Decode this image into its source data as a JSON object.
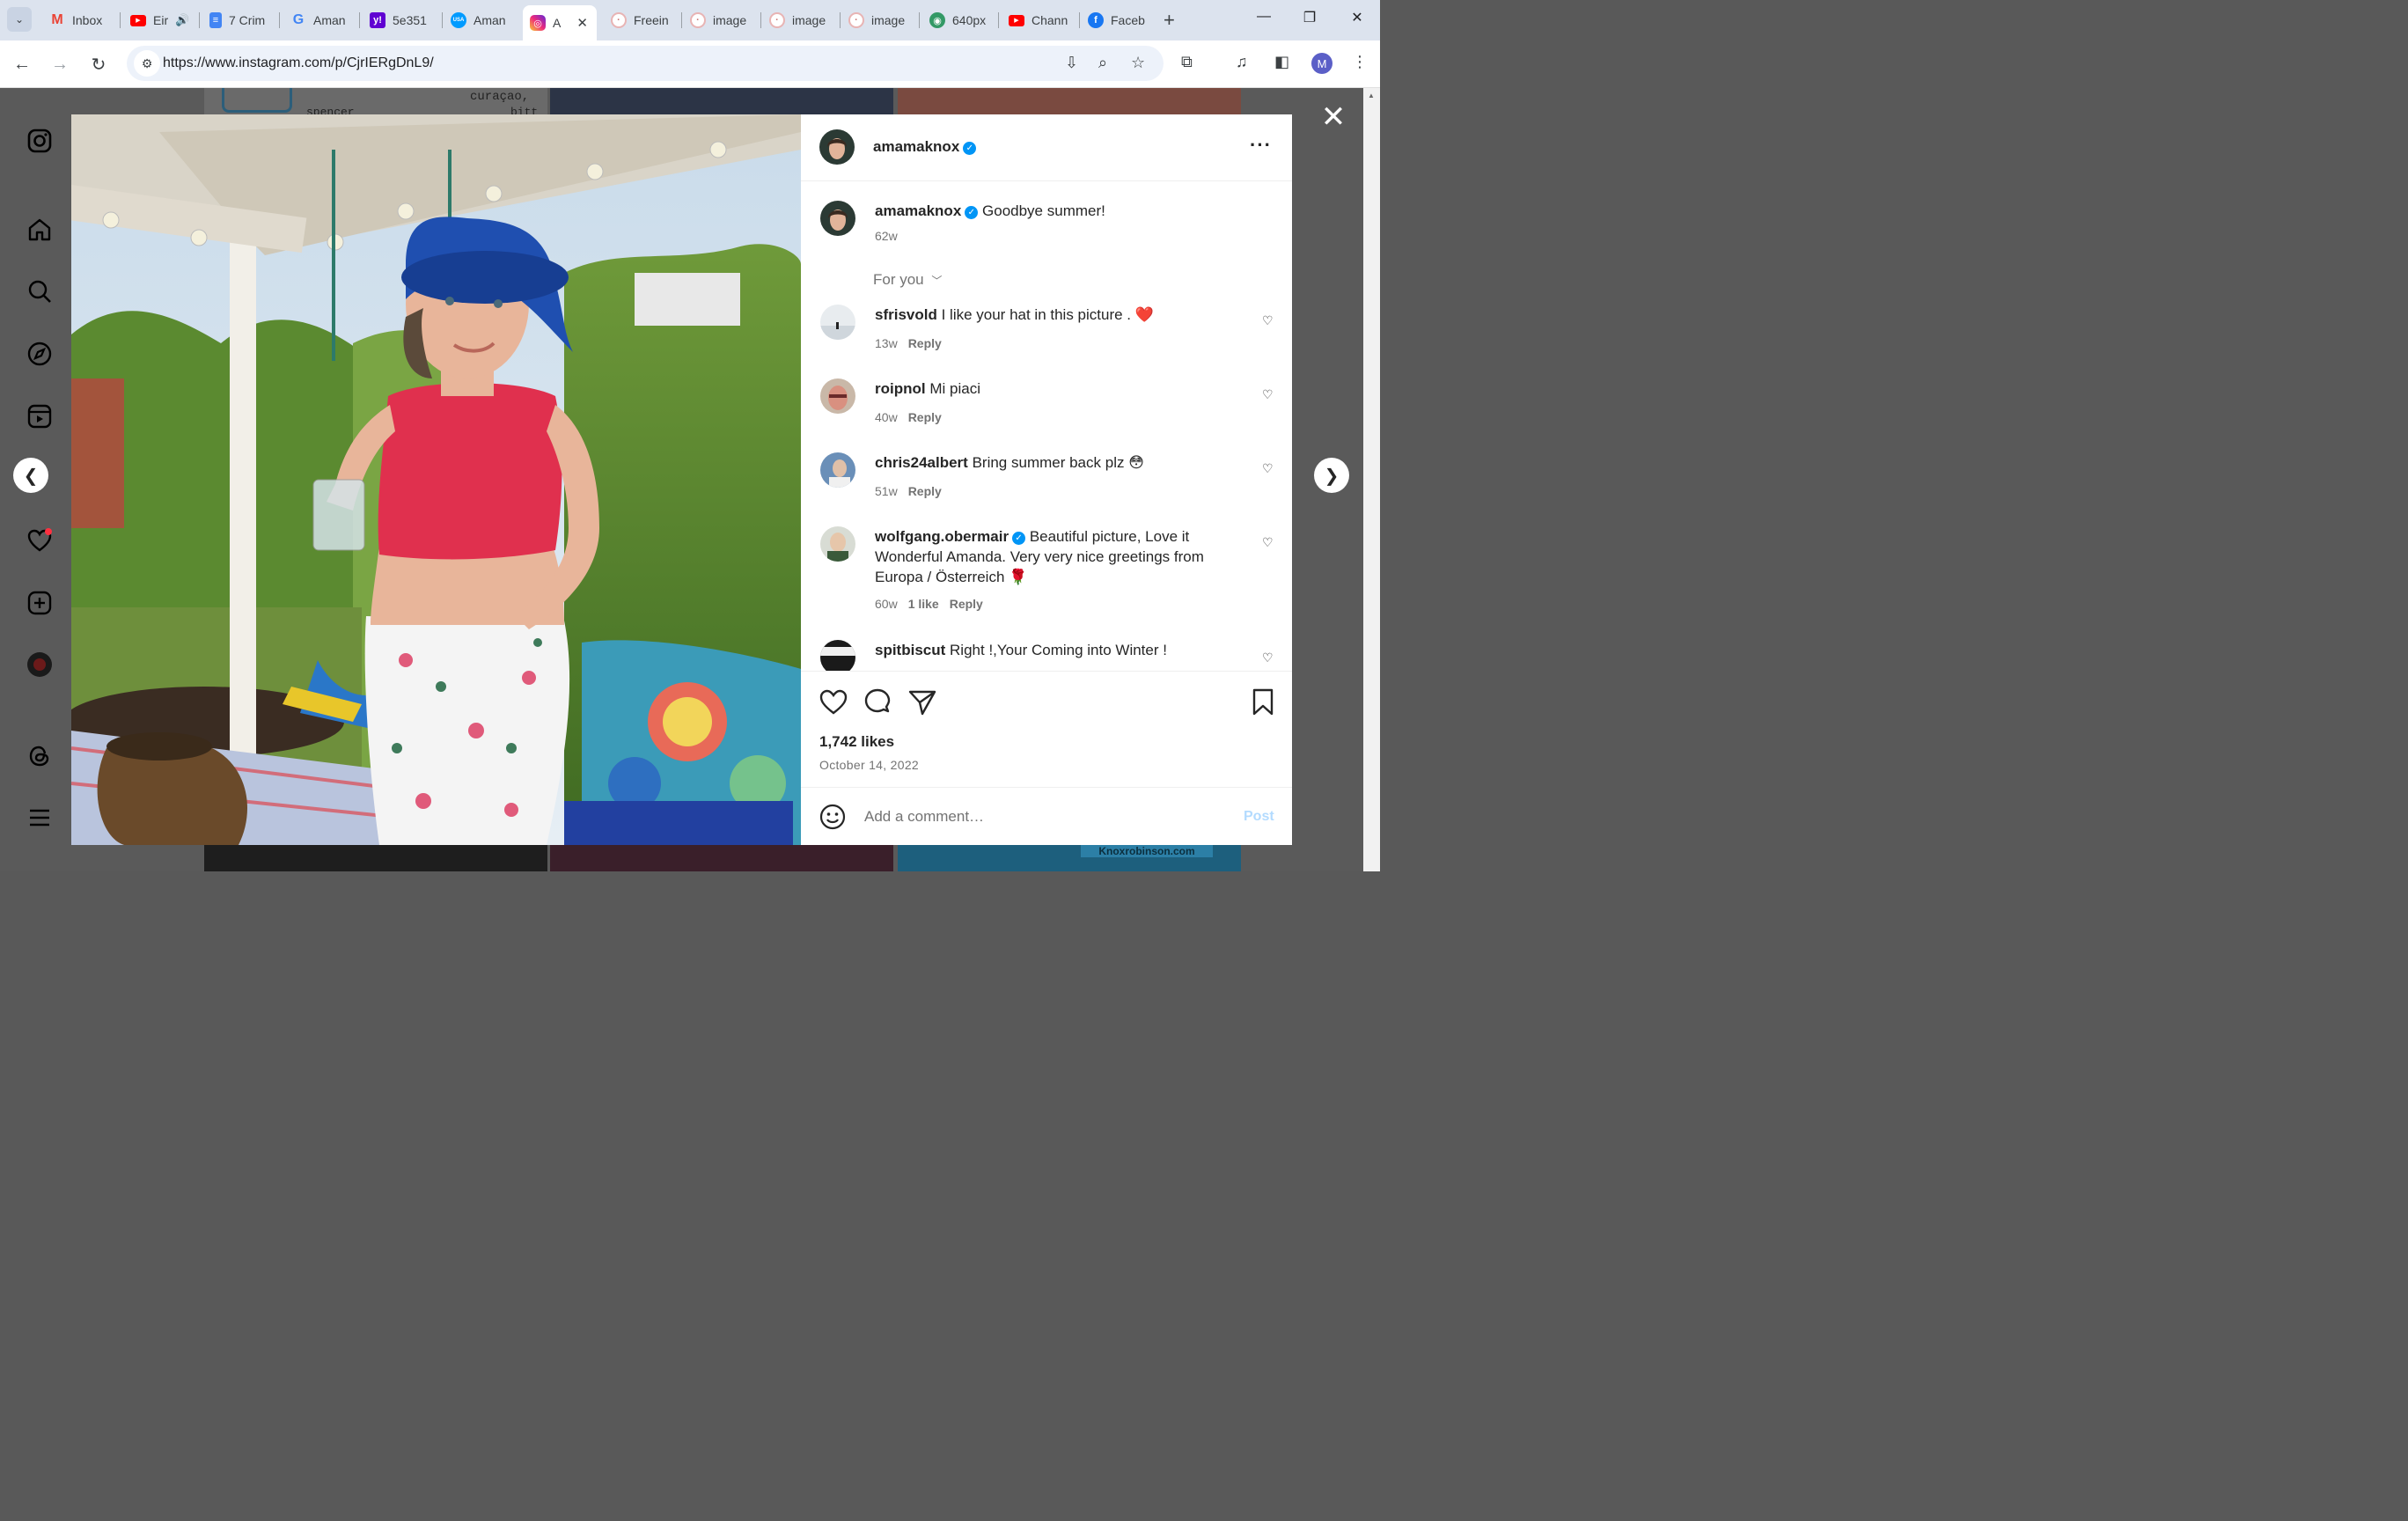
{
  "browser": {
    "tabs": [
      {
        "label": "Inbox",
        "icon": "gmail-icon",
        "color": "#ea4335"
      },
      {
        "label": "Eir",
        "icon": "youtube-icon",
        "color": "#ff0000",
        "audio": true
      },
      {
        "label": "7 Crim",
        "icon": "docs-icon",
        "color": "#4285f4"
      },
      {
        "label": "Aman",
        "icon": "google-icon",
        "color": "#4285f4"
      },
      {
        "label": "5e351",
        "icon": "yahoo-icon",
        "color": "#6001d2"
      },
      {
        "label": "Aman",
        "icon": "usatoday-icon",
        "color": "#009bff"
      },
      {
        "label": "A",
        "icon": "instagram-icon",
        "color": "#e1306c",
        "active": true
      },
      {
        "label": "Freein",
        "icon": "generic-image-icon",
        "color": "#e8b4b4"
      },
      {
        "label": "image",
        "icon": "generic-image-icon",
        "color": "#e8b4b4"
      },
      {
        "label": "image",
        "icon": "generic-image-icon",
        "color": "#e8b4b4"
      },
      {
        "label": "image",
        "icon": "generic-image-icon",
        "color": "#e8b4b4"
      },
      {
        "label": "640px",
        "icon": "wikimedia-icon",
        "color": "#339966"
      },
      {
        "label": "Chann",
        "icon": "youtube-icon",
        "color": "#ff0000"
      },
      {
        "label": "Faceb",
        "icon": "facebook-icon",
        "color": "#1877f2"
      }
    ],
    "url": "https://www.instagram.com/p/CjrIERgDnL9/",
    "profile_initial": "M"
  },
  "post": {
    "username": "amamaknox",
    "caption_user": "amamaknox",
    "caption": "Goodbye summer!",
    "caption_age": "62w",
    "sort_label": "For you",
    "likes": "1,742 likes",
    "date": "October 14, 2022",
    "add_comment_placeholder": "Add a comment…",
    "post_label": "Post",
    "reply_label": "Reply"
  },
  "comments": [
    {
      "user": "sfrisvold",
      "text": "I like your hat in this picture . ",
      "emoji": "❤️",
      "age": "13w",
      "likes": "",
      "verified": false
    },
    {
      "user": "roipnol",
      "text": "Mi piaci",
      "emoji": "",
      "age": "40w",
      "likes": "",
      "verified": false
    },
    {
      "user": "chris24albert",
      "text": "Bring summer back plz ",
      "emoji": "😳",
      "age": "51w",
      "likes": "",
      "verified": false
    },
    {
      "user": "wolfgang.obermair",
      "text": "Beautiful picture, Love it Wonderful Amanda. Very very nice greetings from Europa / Österreich ",
      "emoji": "🌹",
      "age": "60w",
      "likes": "1 like",
      "verified": true
    },
    {
      "user": "spitbiscut",
      "text": "Right !,Your Coming into Winter !",
      "emoji": "",
      "age": "",
      "likes": "",
      "verified": false
    }
  ],
  "background_text": {
    "snippet1": "curaçao, ",
    "snippet2": "spencer",
    "snippet3": "bitt",
    "footer_link": "Knoxrobinson.com"
  },
  "colors": {
    "accent": "#0095f6",
    "heart_notification": "#ff3040",
    "post_disabled": "#b3dbff"
  }
}
